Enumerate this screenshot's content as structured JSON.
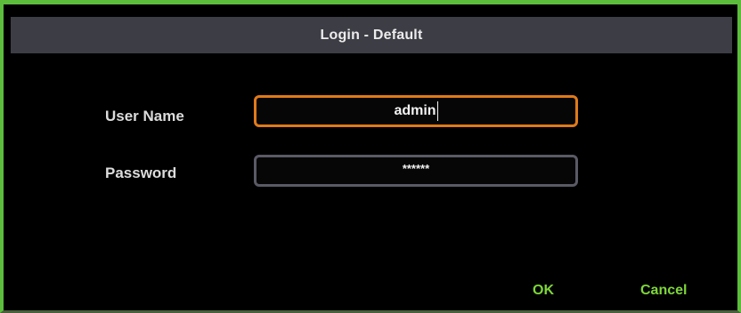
{
  "dialog": {
    "title": "Login - Default"
  },
  "form": {
    "username_label": "User Name",
    "username_value": "admin",
    "password_label": "Password",
    "password_value": "******"
  },
  "buttons": {
    "ok_label": "OK",
    "cancel_label": "Cancel"
  },
  "colors": {
    "frame": "#5cbd3d",
    "titlebar": "#3d3d45",
    "focus_border": "#e07a1a",
    "field_border": "#5a5a66",
    "button_text": "#7ed63a"
  }
}
